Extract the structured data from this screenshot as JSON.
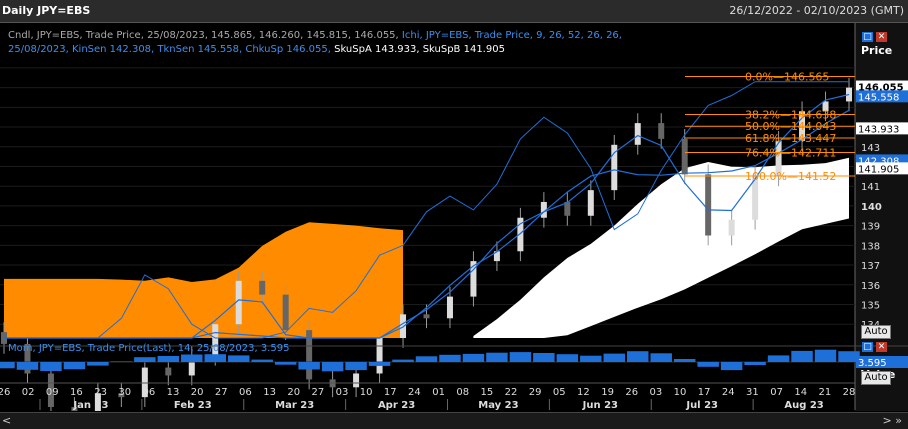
{
  "window": {
    "title": "Daily JPY=EBS",
    "date_range": "26/12/2022 - 02/10/2023 (GMT)"
  },
  "legend": {
    "line1_gray": "Cndl, JPY=EBS, Trade Price, 25/08/2023, 145.865, 146.260, 145.815, 146.055,",
    "line1_blue": "Ichi, JPY=EBS, Trade Price, 9, 26, 52, 26, 26,",
    "line2_blue": "25/08/2023, KinSen 142.308, TknSen 145.558, ChkuSp 146.055,",
    "line2_white": "SkuSpA 143.933, SkuSpB 141.905"
  },
  "mom_legend": "Mom, JPY=EBS, Trade Price(Last), 14, 25/08/2023, 3.595",
  "buttons": {
    "auto": "Auto",
    "close": "✕",
    "restore": "□",
    "scroll_left": "<",
    "scroll_right": "> »"
  },
  "colors": {
    "background": "#000000",
    "candle": "#9a9a9a",
    "cloud_bull": "#ffffff",
    "cloud_bear": "#ff8c00",
    "ichimoku_lines": "#1f6fd9",
    "fib": "#ff8c00",
    "momentum": "#1f6fd9"
  },
  "icons": [
    "restore-icon",
    "close-icon"
  ],
  "chart_data": [
    {
      "type": "candlestick",
      "title": "Daily JPY=EBS",
      "ylabel": "Price",
      "ylim": [
        133.3,
        147.3
      ],
      "y_ticks": [
        134,
        135,
        136,
        137,
        138,
        139,
        140,
        141,
        142,
        143,
        144,
        145,
        146,
        147
      ],
      "y_tick_labels": [
        "134",
        "135",
        "136",
        "137",
        "138",
        "139",
        "140",
        "141",
        "142",
        "143",
        "",
        "",
        "",
        ""
      ],
      "x_day_ticks": [
        "26",
        "02",
        "09",
        "16",
        "23",
        "30",
        "06",
        "13",
        "20",
        "27",
        "06",
        "13",
        "20",
        "27",
        "03",
        "10",
        "17",
        "24",
        "01",
        "08",
        "15",
        "22",
        "29",
        "05",
        "12",
        "19",
        "26",
        "03",
        "10",
        "17",
        "24",
        "31",
        "07",
        "14",
        "21",
        "28"
      ],
      "x_month_ticks": [
        "Jan 23",
        "Feb 23",
        "Mar 23",
        "Apr 23",
        "May 23",
        "Jun 23",
        "Jul 23",
        "Aug 23"
      ],
      "price_axis_labels": [
        {
          "value": 146.055,
          "text": "146.055",
          "style": "last"
        },
        {
          "value": 145.558,
          "text": "145.558",
          "style": "tenkan"
        },
        {
          "value": 143.933,
          "text": "143.933",
          "style": "span_a"
        },
        {
          "value": 142.308,
          "text": "142.308",
          "style": "kijun"
        },
        {
          "value": 141.905,
          "text": "141.905",
          "style": "span_b"
        }
      ],
      "last_price_label": "146.055",
      "fibonacci": [
        {
          "label": "0.0%",
          "value": 146.565,
          "text": "146.565"
        },
        {
          "label": "38.2%",
          "value": 144.638,
          "text": "144.638"
        },
        {
          "label": "50.0%",
          "value": 144.043,
          "text": "144.043"
        },
        {
          "label": "61.8%",
          "value": 143.447,
          "text": "143.447"
        },
        {
          "label": "76.4%",
          "value": 142.711,
          "text": "142.711"
        },
        {
          "label": "100.0%",
          "value": 141.52,
          "text": "141.52"
        }
      ],
      "series": [
        {
          "name": "Cndl",
          "kind": "candles",
          "weekly_close": [
            133.0,
            131.5,
            129.8,
            128.5,
            130.5,
            130.3,
            131.8,
            131.4,
            132.4,
            134.0,
            136.2,
            135.5,
            133.7,
            131.2,
            130.8,
            131.5,
            133.3,
            134.5,
            134.3,
            135.4,
            137.2,
            137.7,
            139.4,
            140.2,
            139.5,
            140.8,
            143.1,
            144.2,
            143.4,
            141.6,
            138.5,
            139.3,
            141.5,
            143.3,
            144.8,
            145.3,
            146.0
          ]
        },
        {
          "name": "TknSen",
          "kind": "line"
        },
        {
          "name": "KinSen",
          "kind": "line"
        },
        {
          "name": "ChkuSp",
          "kind": "line"
        },
        {
          "name": "SkuSpA",
          "kind": "cloud"
        },
        {
          "name": "SkuSpB",
          "kind": "cloud"
        }
      ]
    },
    {
      "type": "bar",
      "title": "Mom, JPY=EBS, Trade Price(Last), 14, 25/08/2023, 3.595",
      "ylabel": "Value",
      "last_value": 3.595,
      "last_value_label": "3.595",
      "series": [
        {
          "name": "Mom",
          "values": [
            -2.1,
            -2.6,
            -3.0,
            -2.4,
            -1.2,
            0.2,
            1.6,
            2.0,
            2.5,
            2.6,
            2.2,
            0.8,
            -0.9,
            -2.5,
            -3.1,
            -2.7,
            -1.3,
            0.8,
            1.9,
            2.4,
            2.7,
            3.1,
            3.3,
            3.0,
            2.6,
            2.1,
            2.8,
            3.6,
            2.9,
            1.0,
            -1.6,
            -2.7,
            -1.0,
            2.2,
            3.7,
            4.1,
            3.595
          ]
        }
      ]
    }
  ]
}
